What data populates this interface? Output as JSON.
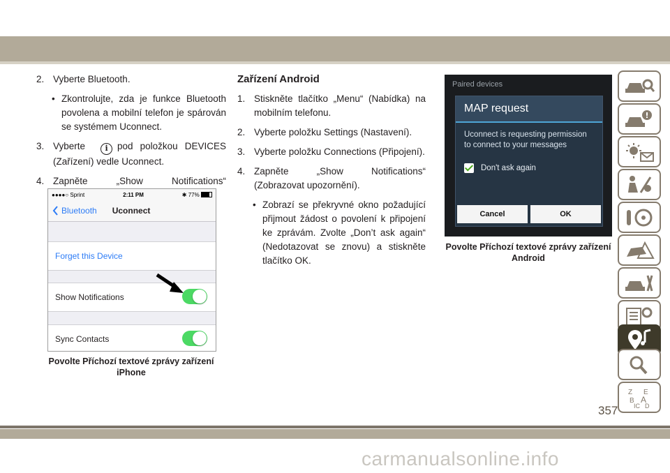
{
  "col1": {
    "step2": {
      "num": "2.",
      "text": "Vyberte Bluetooth."
    },
    "bullet1": "Zkontrolujte, zda je funkce Bluetooth povolena a mobilní telefon je spárován se systémem Uconnect.",
    "step3": {
      "num": "3.",
      "text_before": "Vyberte",
      "text_after": "pod položkou DEVICES (Zařízení) vedle Uconnect."
    },
    "step4": {
      "num": "4.",
      "text": "Zapněte „Show Notifications“ (Zobrazovat upozornění)."
    },
    "caption": "Povolte Příchozí textové zprávy zařízení iPhone"
  },
  "col2": {
    "heading": "Zařízení Android",
    "steps": [
      {
        "num": "1.",
        "text": "Stiskněte tlačítko „Menu“ (Nabídka) na mobilním telefonu."
      },
      {
        "num": "2.",
        "text": "Vyberte položku Settings (Nastavení)."
      },
      {
        "num": "3.",
        "text": "Vyberte položku Connections (Připojení)."
      },
      {
        "num": "4.",
        "text": "Zapněte „Show Notifications“ (Zobrazovat upozornění)."
      }
    ],
    "bullet1": "Zobrazí se překryvné okno požadující přijmout žádost o povolení k připojení ke zprávám. Zvolte „Don’t ask again“ (Nedotazovat se znovu) a stiskněte tlačítko OK."
  },
  "iphone": {
    "status_carrier": "●●●●○ Sprint",
    "status_time": "2:11 PM",
    "status_battery": "77%",
    "back_label": "Bluetooth",
    "title": "Uconnect",
    "forget": "Forget this Device",
    "show_notifications": "Show Notifications",
    "sync_contacts": "Sync Contacts"
  },
  "android": {
    "header": "Paired devices",
    "dialog_title": "MAP request",
    "dialog_body": "Uconnect is requesting permission to connect to your messages",
    "checkbox_label": "Don't ask again",
    "cancel": "Cancel",
    "ok": "OK",
    "caption": "Povolte Příchozí textové zprávy zařízení Android"
  },
  "page_number": "357",
  "watermark": "carmanualsonline.info",
  "colors": {
    "band": "#b2aa99",
    "tab_border": "#857b6d",
    "tab_active": "#3e3a2a",
    "ios_blue": "#2d7cf6",
    "toggle_green": "#4cd964"
  },
  "sidebar_icons": [
    "car-search-icon",
    "car-warning-icon",
    "light-mail-icon",
    "seat-airbag-icon",
    "steering-gear-icon",
    "car-crash-icon",
    "car-tools-icon",
    "list-gear-icon",
    "navigation-music-icon",
    "magnifier-icon",
    "alphabet-index-icon"
  ]
}
